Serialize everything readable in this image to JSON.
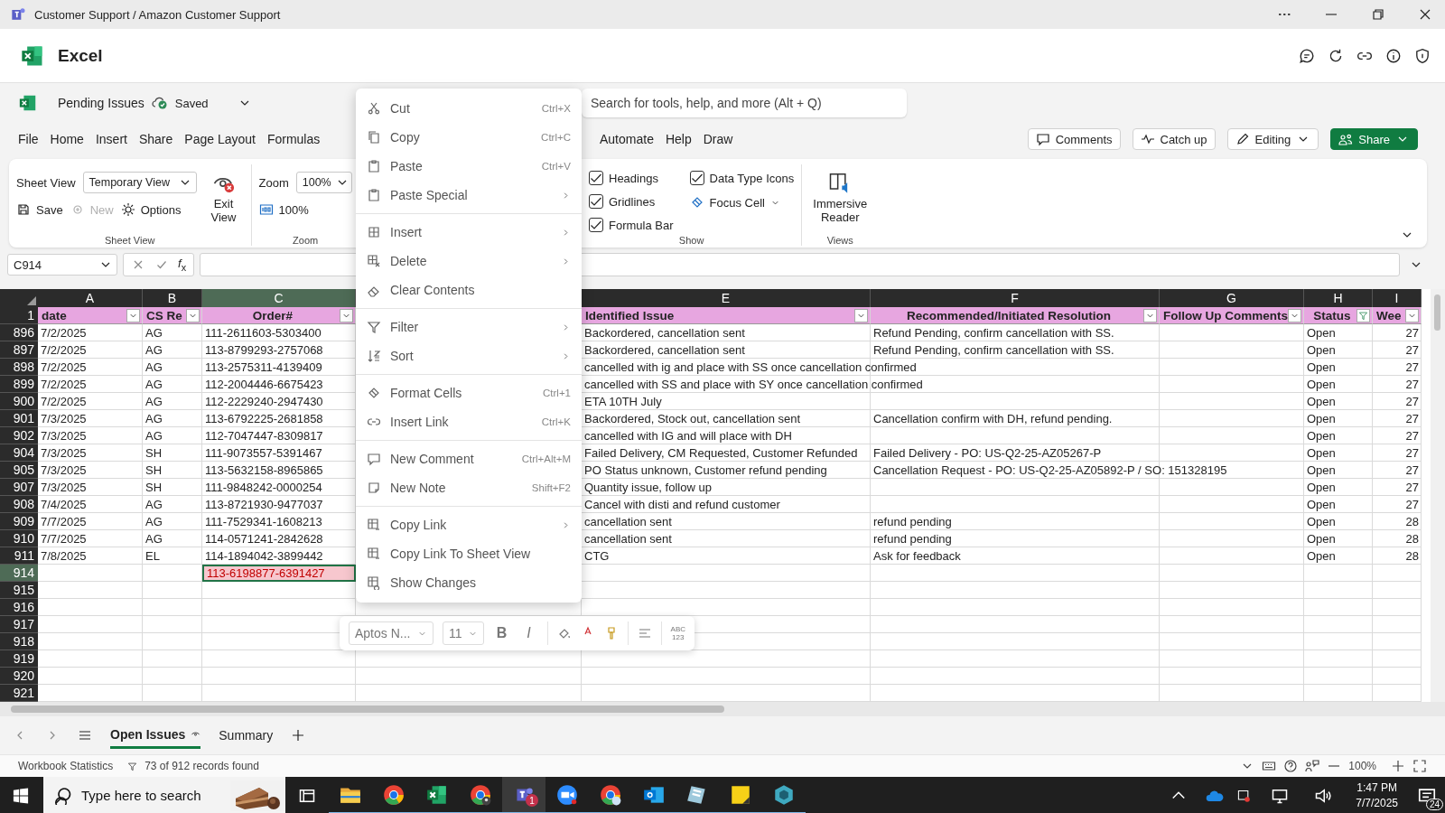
{
  "window": {
    "title": "Customer Support / Amazon Customer Support"
  },
  "app": {
    "name": "Excel"
  },
  "document": {
    "name": "Pending Issues",
    "status": "Saved"
  },
  "search": {
    "placeholder": "Search for tools, help, and more (Alt + Q)"
  },
  "menu_tabs": [
    {
      "label": "File",
      "selected": false
    },
    {
      "label": "Home",
      "selected": false
    },
    {
      "label": "Insert",
      "selected": false
    },
    {
      "label": "Share",
      "selected": false
    },
    {
      "label": "Page Layout",
      "selected": false
    },
    {
      "label": "Formulas",
      "selected": false
    },
    {
      "label": "Automate",
      "selected": false
    },
    {
      "label": "Help",
      "selected": false
    },
    {
      "label": "Draw",
      "selected": false
    }
  ],
  "header_buttons": [
    {
      "label": "Comments",
      "kind": "plain"
    },
    {
      "label": "Catch up",
      "kind": "plain"
    },
    {
      "label": "Editing",
      "kind": "dropdown"
    },
    {
      "label": "Share",
      "kind": "primary"
    }
  ],
  "ribbon": {
    "sheet_view": {
      "label": "Sheet View",
      "view": "Temporary View",
      "exit": "Exit View",
      "group": "Sheet View",
      "actions": [
        {
          "label": "Save",
          "disabled": false
        },
        {
          "label": "New",
          "disabled": true
        },
        {
          "label": "Options",
          "disabled": false
        }
      ]
    },
    "zoom": {
      "label": "Zoom",
      "value": "100%",
      "reset": "100%",
      "group": "Zoom"
    },
    "show": {
      "group": "Show",
      "focus_cell": "Focus Cell",
      "options": [
        {
          "label": "Headings",
          "checked": true
        },
        {
          "label": "Gridlines",
          "checked": true
        },
        {
          "label": "Formula Bar",
          "checked": true
        },
        {
          "label": "Data Type Icons",
          "checked": true
        }
      ]
    },
    "views": {
      "immersive": "Immersive Reader",
      "group": "Views"
    }
  },
  "formula_bar": {
    "name_box": "C914",
    "function": "*f*$_{x}$"
  },
  "sheet": {
    "columns": [
      {
        "kind": "column",
        "letter": "A",
        "heading": "date",
        "selected": false,
        "filtered": false
      },
      {
        "kind": "column",
        "letter": "B",
        "heading": "CS Re",
        "selected": false,
        "filtered": false
      },
      {
        "kind": "column",
        "letter": "C",
        "heading": "Order#",
        "selected": true,
        "filtered": false
      },
      {
        "kind": "covered"
      },
      {
        "kind": "column",
        "letter": "E",
        "heading": "Identified Issue",
        "selected": false,
        "filtered": false
      },
      {
        "kind": "column",
        "letter": "F",
        "heading": "Recommended/Initiated Resolution",
        "selected": false,
        "filtered": false
      },
      {
        "kind": "column",
        "letter": "G",
        "heading": "Follow Up Comments",
        "selected": false,
        "filtered": false
      },
      {
        "kind": "column",
        "letter": "H",
        "heading": "Status",
        "selected": false,
        "filtered": true
      },
      {
        "kind": "column",
        "letter": "I",
        "heading": "Wee",
        "selected": false,
        "filtered": false
      }
    ],
    "header_row": "1",
    "rows": [
      {
        "number": "896",
        "selected": false,
        "flagged": false,
        "cells": {
          "A": "7/2/2025",
          "B": "AG",
          "C": "111-2611603-5303400",
          "E": "Backordered, cancellation sent",
          "F": "Refund Pending, confirm cancellation with SS.",
          "H": "Open",
          "I": "27"
        }
      },
      {
        "number": "897",
        "selected": false,
        "flagged": false,
        "cells": {
          "A": "7/2/2025",
          "B": "AG",
          "C": "113-8799293-2757068",
          "E": "Backordered, cancellation sent",
          "F": "Refund Pending, confirm cancellation with SS.",
          "H": "Open",
          "I": "27"
        }
      },
      {
        "number": "898",
        "selected": false,
        "flagged": false,
        "cells": {
          "A": "7/2/2025",
          "B": "AG",
          "C": "113-2575311-4139409",
          "E": "cancelled with ig and place with SS once cancellation confirmed",
          "H": "Open",
          "I": "27"
        }
      },
      {
        "number": "899",
        "selected": false,
        "flagged": false,
        "cells": {
          "A": "7/2/2025",
          "B": "AG",
          "C": "112-2004446-6675423",
          "E": "cancelled with SS and place with SY once cancellation confirmed",
          "H": "Open",
          "I": "27"
        }
      },
      {
        "number": "900",
        "selected": false,
        "flagged": false,
        "cells": {
          "A": "7/2/2025",
          "B": "AG",
          "C": "112-2229240-2947430",
          "E": "ETA 10TH July",
          "H": "Open",
          "I": "27"
        }
      },
      {
        "number": "901",
        "selected": false,
        "flagged": false,
        "cells": {
          "A": "7/3/2025",
          "B": "AG",
          "C": "113-6792225-2681858",
          "E": "Backordered, Stock out, cancellation sent",
          "F": "Cancellation confirm with DH, refund pending.",
          "H": "Open",
          "I": "27"
        }
      },
      {
        "number": "902",
        "selected": false,
        "flagged": false,
        "cells": {
          "A": "7/3/2025",
          "B": "AG",
          "C": "112-7047447-8309817",
          "E": "cancelled with IG and will place with DH",
          "H": "Open",
          "I": "27"
        }
      },
      {
        "number": "904",
        "selected": false,
        "flagged": false,
        "cells": {
          "A": "7/3/2025",
          "B": "SH",
          "C": "111-9073557-5391467",
          "E": "Failed Delivery, CM Requested, Customer Refunded",
          "F": "Failed Delivery - PO: US-Q2-25-AZ05267-P",
          "H": "Open",
          "I": "27"
        }
      },
      {
        "number": "905",
        "selected": false,
        "flagged": false,
        "cells": {
          "A": "7/3/2025",
          "B": "SH",
          "C": "113-5632158-8965865",
          "E": "PO Status unknown, Customer refund pending",
          "F": "Cancellation Request - PO: US-Q2-25-AZ05892-P / SO: 151328195",
          "H": "Open",
          "I": "27"
        }
      },
      {
        "number": "907",
        "selected": false,
        "flagged": false,
        "cells": {
          "A": "7/3/2025",
          "B": "SH",
          "C": "111-9848242-0000254",
          "E": "Quantity issue, follow up",
          "H": "Open",
          "I": "27"
        }
      },
      {
        "number": "908",
        "selected": false,
        "flagged": false,
        "cells": {
          "A": "7/4/2025",
          "B": "AG",
          "C": "113-8721930-9477037",
          "E": "Cancel with disti and refund customer",
          "H": "Open",
          "I": "27"
        }
      },
      {
        "number": "909",
        "selected": false,
        "flagged": false,
        "cells": {
          "A": "7/7/2025",
          "B": "AG",
          "C": "111-7529341-1608213",
          "E": "cancellation sent",
          "F": "refund pending",
          "H": "Open",
          "I": "28"
        }
      },
      {
        "number": "910",
        "selected": false,
        "flagged": false,
        "cells": {
          "A": "7/7/2025",
          "B": "AG",
          "C": "114-0571241-2842628",
          "E": "cancellation sent",
          "F": "refund pending",
          "H": "Open",
          "I": "28"
        }
      },
      {
        "number": "911",
        "selected": false,
        "flagged": false,
        "cells": {
          "A": "7/8/2025",
          "B": "EL",
          "C": "114-1894042-3899442",
          "E": "CTG",
          "F": "Ask for feedback",
          "H": "Open",
          "I": "28"
        }
      },
      {
        "number": "914",
        "selected": true,
        "flagged": true,
        "cells": {
          "C": "113-6198877-6391427"
        }
      },
      {
        "number": "915",
        "selected": false
      },
      {
        "number": "916",
        "selected": false
      },
      {
        "number": "917",
        "selected": false
      },
      {
        "number": "918",
        "selected": false
      },
      {
        "number": "919",
        "selected": false
      },
      {
        "number": "920",
        "selected": false
      },
      {
        "number": "921",
        "selected": false
      }
    ]
  },
  "context_menu": {
    "groups": [
      [
        {
          "label": "Cut",
          "shortcut": "Ctrl+X",
          "submenu": false
        },
        {
          "label": "Copy",
          "shortcut": "Ctrl+C",
          "submenu": false
        },
        {
          "label": "Paste",
          "shortcut": "Ctrl+V",
          "submenu": false
        },
        {
          "label": "Paste Special",
          "submenu": true
        }
      ],
      [
        {
          "label": "Insert",
          "submenu": true
        },
        {
          "label": "Delete",
          "submenu": true
        },
        {
          "label": "Clear Contents",
          "submenu": false
        }
      ],
      [
        {
          "label": "Filter",
          "submenu": true
        },
        {
          "label": "Sort",
          "submenu": true
        }
      ],
      [
        {
          "label": "Format Cells",
          "shortcut": "Ctrl+1",
          "submenu": false
        },
        {
          "label": "Insert Link",
          "shortcut": "Ctrl+K",
          "submenu": false
        }
      ],
      [
        {
          "label": "New Comment",
          "shortcut": "Ctrl+Alt+M",
          "submenu": false
        },
        {
          "label": "New Note",
          "shortcut": "Shift+F2",
          "submenu": false
        }
      ],
      [
        {
          "label": "Copy Link",
          "submenu": true
        },
        {
          "label": "Copy Link To Sheet View",
          "submenu": false
        },
        {
          "label": "Show Changes",
          "submenu": false
        }
      ]
    ]
  },
  "mini_toolbar": {
    "font": "Aptos N...",
    "size": "11",
    "bold": "B",
    "italic": "I",
    "number_format": [
      "ABC",
      "123"
    ]
  },
  "sheet_tabs": [
    {
      "label": "Open Issues",
      "selected": true
    },
    {
      "label": "Summary",
      "selected": false
    }
  ],
  "status_bar": {
    "statistics": "Workbook Statistics",
    "records": "73 of 912 records found",
    "zoom": "100%"
  },
  "taskbar": {
    "search": "Type here to search",
    "time": "1:47 PM",
    "date": "7/7/2025",
    "notifications": "24",
    "apps": [
      {
        "active": false
      },
      {
        "active": false
      },
      {
        "active": false
      },
      {
        "active": false
      },
      {
        "active": true,
        "badge": "1"
      },
      {
        "active": false
      },
      {
        "active": false
      },
      {
        "active": false
      },
      {
        "active": false
      },
      {
        "active": false
      },
      {
        "active": false
      }
    ]
  }
}
